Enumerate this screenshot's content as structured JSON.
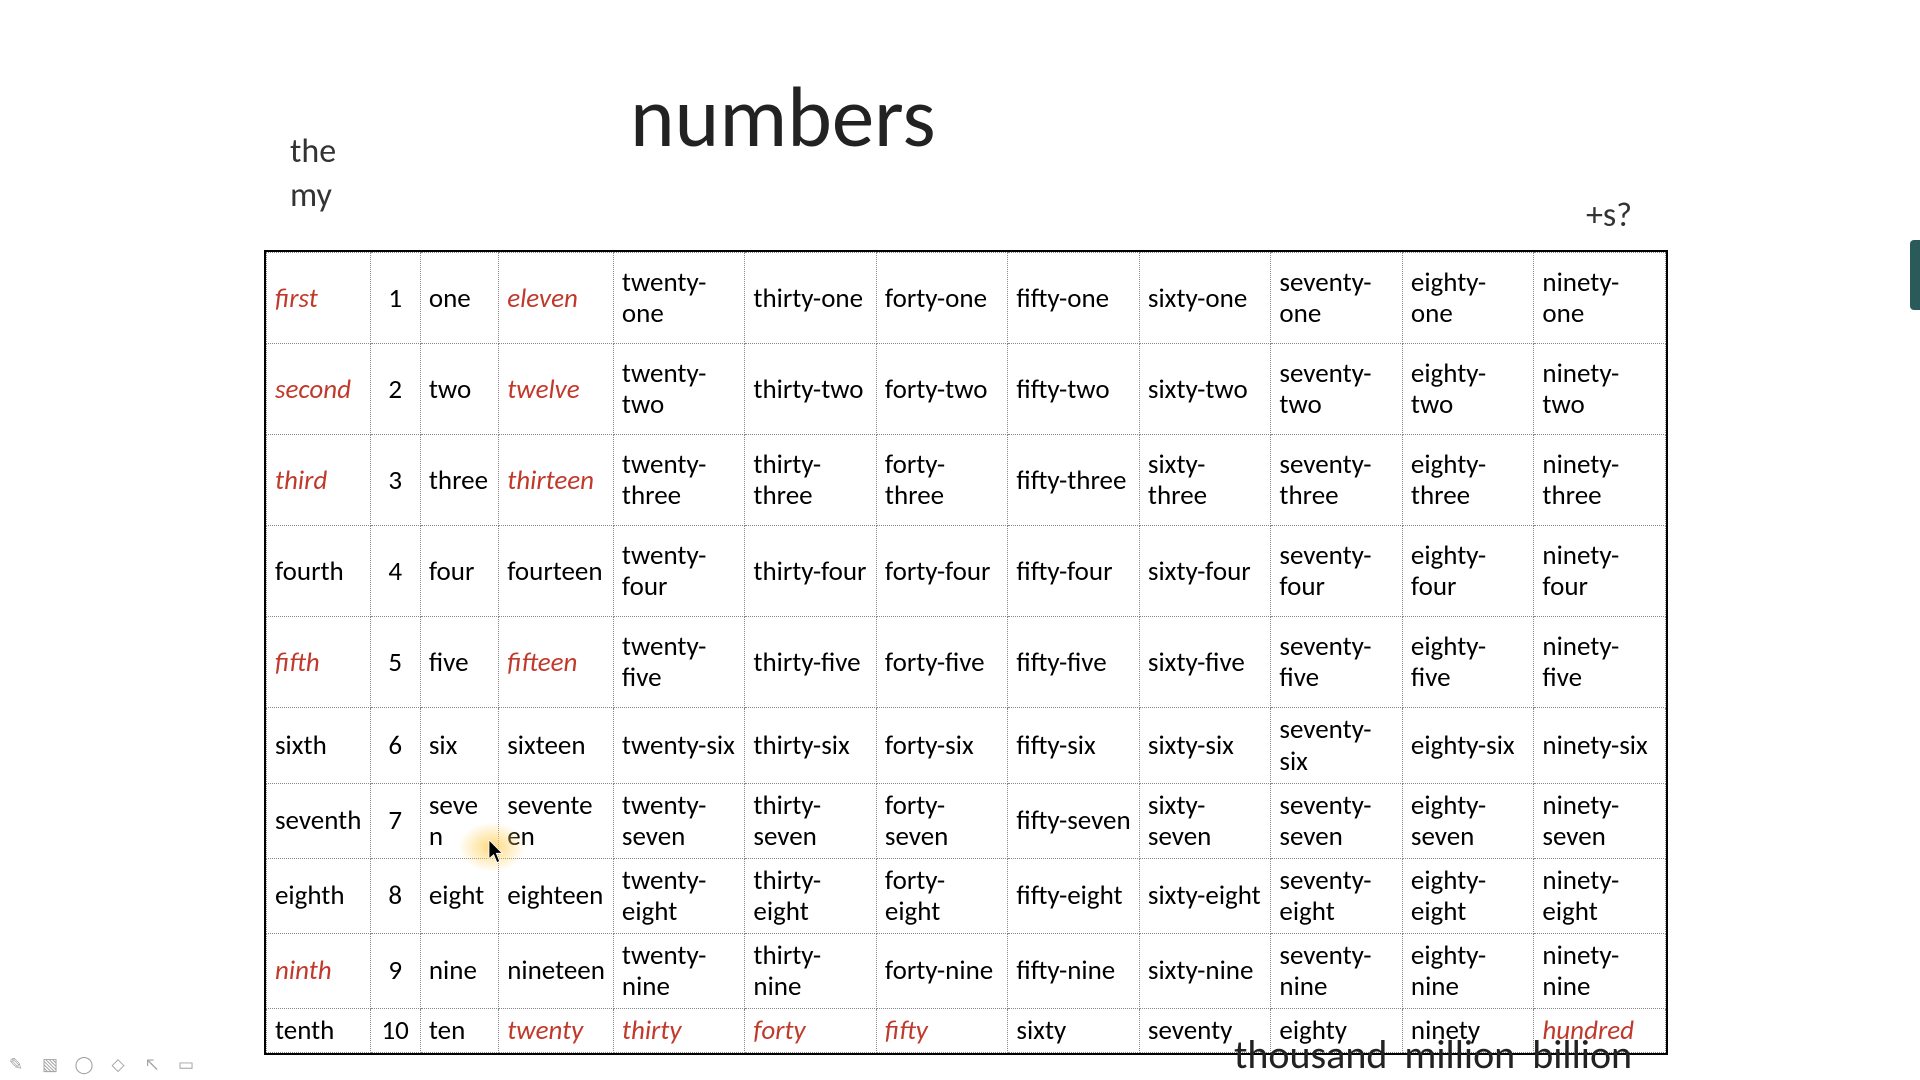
{
  "title": "numbers",
  "corner": {
    "line1": "the",
    "line2": "my"
  },
  "plus_s": "+s?",
  "big_numbers": "thousand  million  billion",
  "red_cells": [
    "0-0",
    "0-3",
    "1-0",
    "1-3",
    "2-0",
    "2-3",
    "4-0",
    "4-3",
    "8-0",
    "9-3",
    "9-4",
    "9-5",
    "9-6",
    "9-11"
  ],
  "tall_rows": [
    0,
    1,
    2,
    3,
    4
  ],
  "rows": [
    [
      "first",
      "1",
      "one",
      "eleven",
      "twenty-one",
      "thirty-one",
      "forty-one",
      "fifty-one",
      "sixty-one",
      "seventy-one",
      "eighty-one",
      "ninety-one"
    ],
    [
      "second",
      "2",
      "two",
      "twelve",
      "twenty-two",
      "thirty-two",
      "forty-two",
      "fifty-two",
      "sixty-two",
      "seventy-two",
      "eighty-two",
      "ninety-two"
    ],
    [
      "third",
      "3",
      "three",
      "thirteen",
      "twenty-three",
      "thirty-three",
      "forty-three",
      "fifty-three",
      "sixty-three",
      "seventy-three",
      "eighty-three",
      "ninety-three"
    ],
    [
      "fourth",
      "4",
      "four",
      "fourteen",
      "twenty-four",
      "thirty-four",
      "forty-four",
      "fifty-four",
      "sixty-four",
      "seventy-four",
      "eighty-four",
      "ninety-four"
    ],
    [
      "fifth",
      "5",
      "five",
      "fifteen",
      "twenty-five",
      "thirty-five",
      "forty-five",
      "fifty-five",
      "sixty-five",
      "seventy-five",
      "eighty-five",
      "ninety-five"
    ],
    [
      "sixth",
      "6",
      "six",
      "sixteen",
      "twenty-six",
      "thirty-six",
      "forty-six",
      "fifty-six",
      "sixty-six",
      "seventy-six",
      "eighty-six",
      "ninety-six"
    ],
    [
      "seventh",
      "7",
      "seven",
      "seventeen",
      "twenty-seven",
      "thirty-seven",
      "forty-seven",
      "fifty-seven",
      "sixty-seven",
      "seventy-seven",
      "eighty-seven",
      "ninety-seven"
    ],
    [
      "eighth",
      "8",
      "eight",
      "eighteen",
      "twenty-eight",
      "thirty-eight",
      "forty-eight",
      "fifty-eight",
      "sixty-eight",
      "seventy-eight",
      "eighty-eight",
      "ninety-eight"
    ],
    [
      "ninth",
      "9",
      "nine",
      "nineteen",
      "twenty-nine",
      "thirty-nine",
      "forty-nine",
      "fifty-nine",
      "sixty-nine",
      "seventy-nine",
      "eighty-nine",
      "ninety-nine"
    ],
    [
      "tenth",
      "10",
      "ten",
      "twenty",
      "thirty",
      "forty",
      "fifty",
      "sixty",
      "seventy",
      "eighty",
      "ninety",
      "hundred"
    ]
  ],
  "toolbar_icons": [
    "pen-icon",
    "image-icon",
    "circle-icon",
    "diamond-icon",
    "pointer-icon",
    "screen-icon"
  ]
}
